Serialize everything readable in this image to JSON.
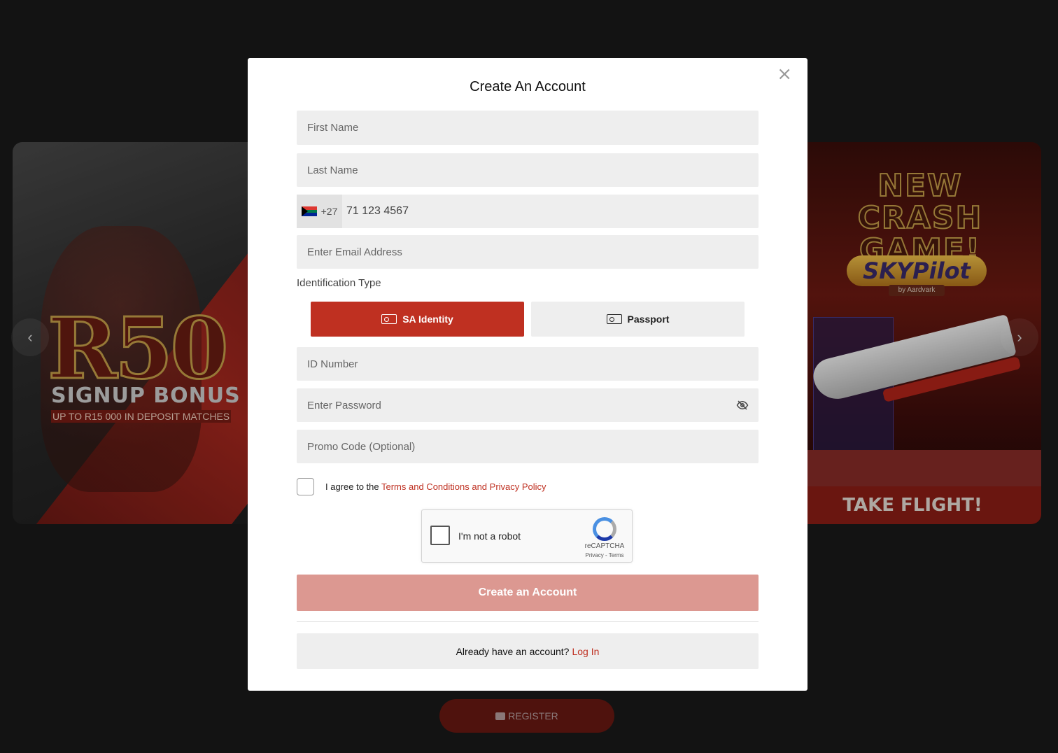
{
  "background": {
    "left_banner": {
      "amount": "R50",
      "title": "SIGNUP BONUS",
      "subtitle": "UP TO R15 000 IN DEPOSIT MATCHES"
    },
    "right_banner": {
      "title_line1": "NEW CRASH",
      "title_line2": "GAME!",
      "logo": "SKYPilot",
      "logo_by": "by Aardvark",
      "cta": "TAKE FLIGHT!"
    },
    "prev_arrow": "‹",
    "next_arrow": "›",
    "register_label": "REGISTER"
  },
  "modal": {
    "title": "Create An Account",
    "close_glyph": "×",
    "fields": {
      "first_name_placeholder": "First Name",
      "last_name_placeholder": "Last Name",
      "country_code": "+27",
      "phone_value": "71 123 4567",
      "email_placeholder": "Enter Email Address",
      "id_number_placeholder": "ID Number",
      "password_placeholder": "Enter Password",
      "promo_placeholder": "Promo Code (Optional)"
    },
    "identification": {
      "label": "Identification Type",
      "options": [
        {
          "label": "SA Identity",
          "selected": true
        },
        {
          "label": "Passport",
          "selected": false
        }
      ]
    },
    "terms": {
      "prefix": "I agree to the ",
      "link": "Terms and Conditions and Privacy Policy"
    },
    "captcha": {
      "label": "I'm not a robot",
      "brand": "reCAPTCHA",
      "links": "Privacy - Terms"
    },
    "submit_label": "Create an Account",
    "login_prompt": "Already have an account?",
    "login_link": "Log In"
  },
  "colors": {
    "accent": "#bf3021",
    "submit_disabled": "#dc9891",
    "field_bg": "#eeeeee"
  }
}
